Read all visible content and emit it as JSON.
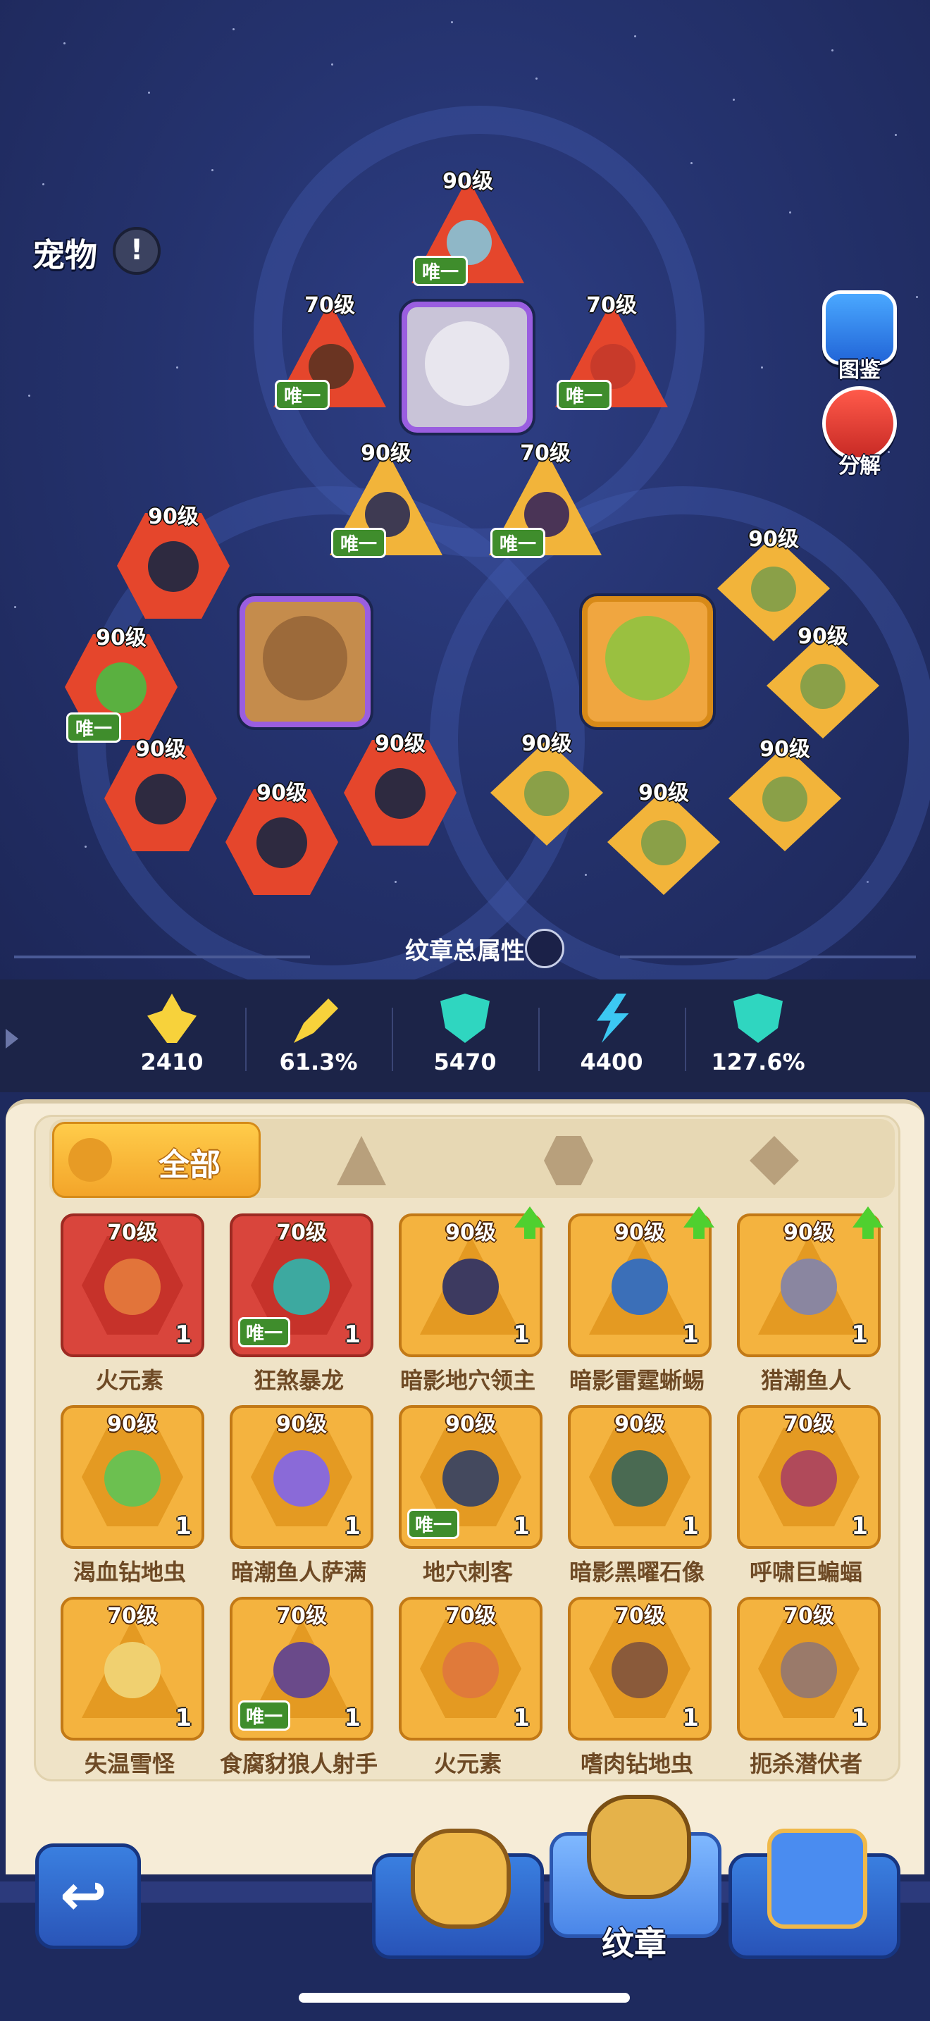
{
  "header": {
    "title": "宠物",
    "warning_icon": "exclamation-icon",
    "side_buttons": [
      {
        "label": "图鉴",
        "icon": "book-icon"
      },
      {
        "label": "分解",
        "icon": "recycle-icon"
      }
    ]
  },
  "slots": {
    "top_group": [
      {
        "level": "90级",
        "shape": "triangle",
        "unique": "唯一"
      },
      {
        "level": "70级",
        "shape": "triangle",
        "unique": "唯一"
      },
      {
        "level": "70级",
        "shape": "triangle",
        "unique": "唯一"
      },
      {
        "level": "90级",
        "shape": "triangle",
        "unique": "唯一"
      },
      {
        "level": "70级",
        "shape": "triangle",
        "unique": "唯一"
      }
    ],
    "left_group": [
      {
        "level": "90级",
        "shape": "hexagon"
      },
      {
        "level": "90级",
        "shape": "hexagon",
        "unique": "唯一"
      },
      {
        "level": "90级",
        "shape": "hexagon"
      },
      {
        "level": "90级",
        "shape": "hexagon"
      },
      {
        "level": "90级",
        "shape": "hexagon"
      }
    ],
    "right_group": [
      {
        "level": "90级",
        "shape": "diamond"
      },
      {
        "level": "90级",
        "shape": "diamond"
      },
      {
        "level": "90级",
        "shape": "diamond"
      },
      {
        "level": "90级",
        "shape": "diamond"
      },
      {
        "level": "90级",
        "shape": "diamond"
      }
    ]
  },
  "attributes": {
    "title": "纹章总属性",
    "stats": [
      {
        "icon": "attack-icon",
        "value": "2410",
        "color": "#f7d23b"
      },
      {
        "icon": "crit-sword-icon",
        "value": "61.3%",
        "color": "#f7d23b"
      },
      {
        "icon": "shield-icon",
        "value": "5470",
        "color": "#2fd6c0"
      },
      {
        "icon": "lightning-icon",
        "value": "4400",
        "color": "#3cc8f2"
      },
      {
        "icon": "shield-crit-icon",
        "value": "127.6%",
        "color": "#2fd6c0"
      }
    ]
  },
  "filter_tabs": {
    "all_label": "全部",
    "others": [
      "triangle-filter-icon",
      "hexagon-filter-icon",
      "diamond-filter-icon"
    ]
  },
  "inventory": [
    {
      "name": "火元素",
      "level": "70级",
      "count": "1",
      "frame": "red",
      "shape": "hexagon"
    },
    {
      "name": "狂煞暴龙",
      "level": "70级",
      "count": "1",
      "frame": "red",
      "shape": "hexagon",
      "unique": "唯一"
    },
    {
      "name": "暗影地穴领主",
      "level": "90级",
      "count": "1",
      "frame": "gold",
      "shape": "triangle",
      "upgrade": true
    },
    {
      "name": "暗影雷霆蜥蜴",
      "level": "90级",
      "count": "1",
      "frame": "gold",
      "shape": "triangle",
      "upgrade": true
    },
    {
      "name": "猎潮鱼人",
      "level": "90级",
      "count": "1",
      "frame": "gold",
      "shape": "triangle",
      "upgrade": true
    },
    {
      "name": "渴血钻地虫",
      "level": "90级",
      "count": "1",
      "frame": "gold",
      "shape": "hexagon"
    },
    {
      "name": "暗潮鱼人萨满",
      "level": "90级",
      "count": "1",
      "frame": "gold",
      "shape": "hexagon"
    },
    {
      "name": "地穴刺客",
      "level": "90级",
      "count": "1",
      "frame": "gold",
      "shape": "hexagon",
      "unique": "唯一"
    },
    {
      "name": "暗影黑曜石像",
      "level": "90级",
      "count": "1",
      "frame": "gold",
      "shape": "hexagon"
    },
    {
      "name": "呼啸巨蝙蝠",
      "level": "70级",
      "count": "1",
      "frame": "gold",
      "shape": "hexagon"
    },
    {
      "name": "失温雪怪",
      "level": "70级",
      "count": "1",
      "frame": "gold",
      "shape": "triangle"
    },
    {
      "name": "食腐豺狼人射手",
      "level": "70级",
      "count": "1",
      "frame": "gold",
      "shape": "triangle",
      "unique": "唯一"
    },
    {
      "name": "火元素",
      "level": "70级",
      "count": "1",
      "frame": "gold",
      "shape": "hexagon"
    },
    {
      "name": "嗜肉钻地虫",
      "level": "70级",
      "count": "1",
      "frame": "gold",
      "shape": "hexagon"
    },
    {
      "name": "扼杀潜伏者",
      "level": "70级",
      "count": "1",
      "frame": "gold",
      "shape": "hexagon"
    }
  ],
  "bottom_nav": {
    "back_icon": "return-arrow-icon",
    "items": [
      {
        "icon": "paw-shield-icon"
      },
      {
        "icon": "emblem-icon",
        "label": "纹章",
        "active": true
      },
      {
        "icon": "paw-book-icon"
      }
    ]
  }
}
